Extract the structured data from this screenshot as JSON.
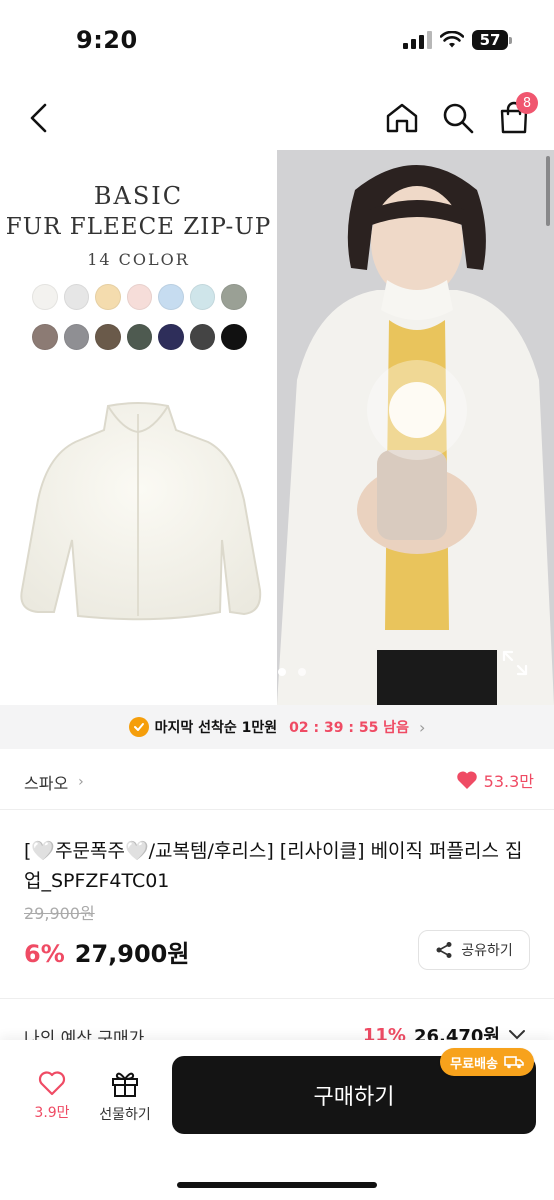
{
  "status_bar": {
    "time": "9:20",
    "battery": "57"
  },
  "nav": {
    "cart_count": "8"
  },
  "hero": {
    "title_line1": "BASIC",
    "title_line2": "FUR FLEECE ZIP-UP",
    "title_line3": "14 COLOR",
    "swatch_colors_row1": [
      "#f3f2ef",
      "#e6e6e6",
      "#f4dcae",
      "#f6ddd9",
      "#c6dcf0",
      "#cfe5ea",
      "#9aa095"
    ],
    "swatch_colors_row2": [
      "#8c7b74",
      "#8f8f93",
      "#6a5a4a",
      "#4e5a50",
      "#2e2e5a",
      "#444444",
      "#111111"
    ],
    "carousel_pages": 3,
    "carousel_active": 1
  },
  "promo": {
    "label": "마지막 선착순 1만원",
    "timer": "02 : 39 : 55 남음",
    "chevron": "›"
  },
  "brand": {
    "name": "스파오",
    "chevron": "›",
    "likes": "53.3만"
  },
  "product": {
    "title": "[🤍주문폭주🤍/교복템/후리스] [리사이클] 베이직 퍼플리스 집업_SPFZF4TC01",
    "original_price": "29,900원",
    "discount": "6%",
    "price": "27,900원",
    "share_label": "공유하기"
  },
  "estimate": {
    "label": "나의 예상 구매가",
    "discount": "11%",
    "price": "26,470원"
  },
  "bottom_bar": {
    "wish_count": "3.9만",
    "gift_label": "선물하기",
    "buy_label": "구매하기",
    "free_shipping": "무료배송"
  },
  "colors": {
    "accent": "#ef4b64",
    "promo_orange": "#f59e0b",
    "buy_button": "#141414"
  }
}
